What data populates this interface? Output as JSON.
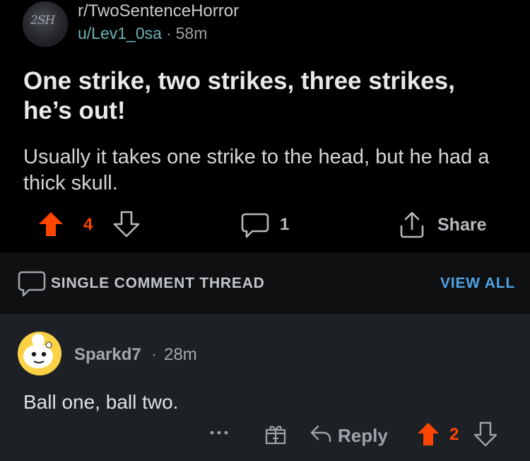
{
  "post": {
    "subreddit": "r/TwoSentenceHorror",
    "subreddit_avatar_text": "2SH",
    "author": "u/Lev1_0sa",
    "separator": "·",
    "age": "58m",
    "title": "One strike, two strikes, three strikes, he’s out!",
    "body": "Usually it takes one strike to the head, but he had a thick skull.",
    "score": "4",
    "comments": "1",
    "share_label": "Share",
    "upvote_color": "#ff4500"
  },
  "thread_bar": {
    "label": "SINGLE COMMENT THREAD",
    "view_all": "VIEW ALL",
    "link_color": "#4fa3e3"
  },
  "comment": {
    "author": "Sparkd7",
    "separator": "·",
    "age": "28m",
    "body": "Ball one, ball two.",
    "reply_label": "Reply",
    "score": "2",
    "upvote_color": "#ff4500"
  },
  "icons": [
    "upvote-icon",
    "downvote-icon",
    "comment-icon",
    "share-icon",
    "more-icon",
    "award-icon",
    "reply-icon"
  ]
}
